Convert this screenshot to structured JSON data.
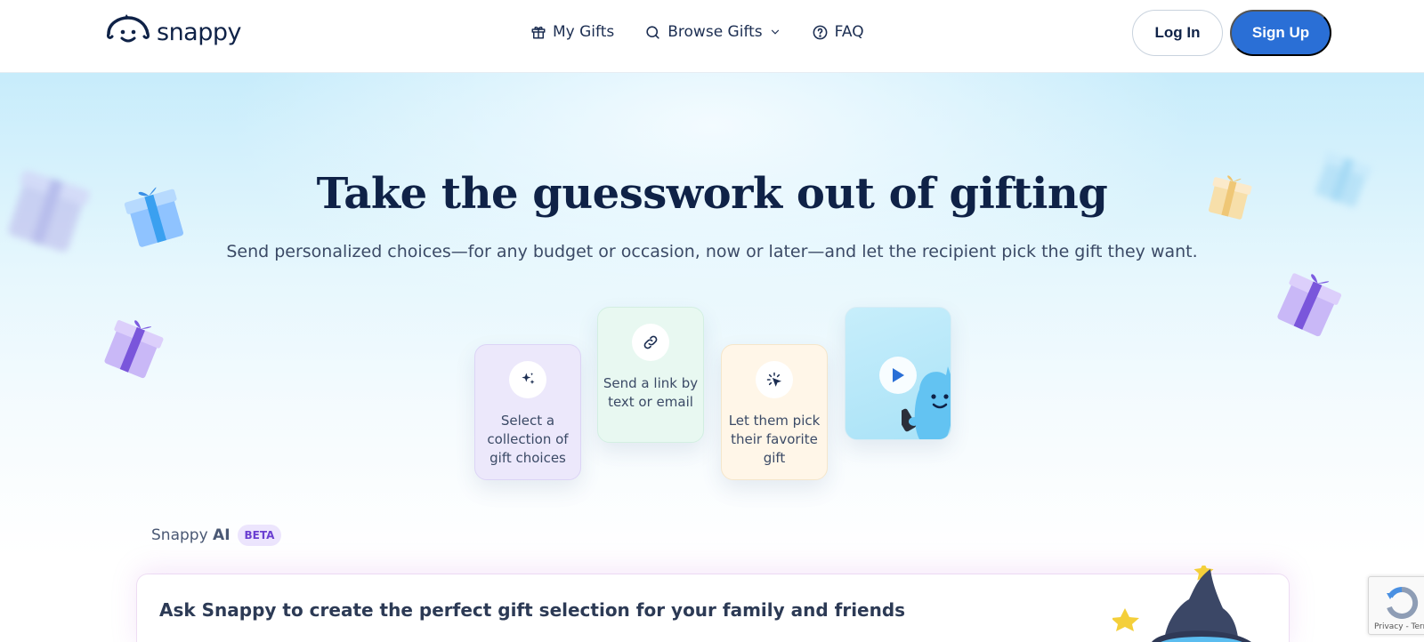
{
  "brand": {
    "name": "snappy"
  },
  "nav": {
    "items": [
      {
        "label": "My Gifts",
        "icon": "gift-icon"
      },
      {
        "label": "Browse Gifts",
        "icon": "search-icon"
      },
      {
        "label": "FAQ",
        "icon": "question-circle-icon"
      }
    ]
  },
  "auth": {
    "login_label": "Log In",
    "signup_label": "Sign Up"
  },
  "hero": {
    "title": "Take the guesswork out of gifting",
    "subtitle": "Send personalized choices—for any budget or occasion, now or later—and let the recipient pick the gift they want."
  },
  "steps": [
    {
      "label": "Select a collection of gift choices",
      "icon": "sparkles-icon"
    },
    {
      "label": "Send a link by text or email",
      "icon": "link-icon"
    },
    {
      "label": "Let them pick their favorite gift",
      "icon": "cursor-click-icon"
    }
  ],
  "ai": {
    "label_prefix": "Snappy",
    "label_bold": "AI",
    "badge": "BETA",
    "card_title": "Ask Snappy to create the perfect gift selection for your family and friends"
  },
  "recaptcha": {
    "text": "Privacy - Terms"
  },
  "colors": {
    "primary": "#2a6fd6",
    "navy": "#0f2247",
    "beta": "#6a3fd1"
  }
}
